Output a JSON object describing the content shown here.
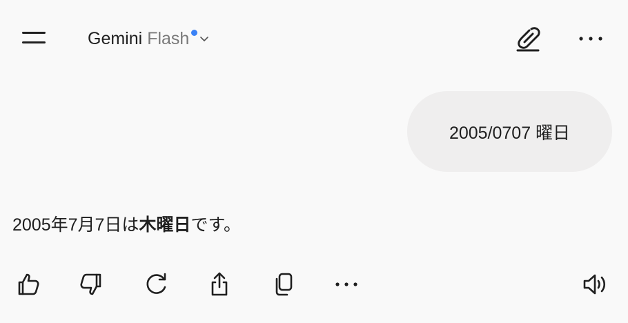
{
  "header": {
    "model_name": "Gemini",
    "model_variant": "Flash",
    "icons": [
      "menu-icon",
      "chevron-down-icon",
      "new-chat-icon",
      "more-horizontal-icon"
    ]
  },
  "conversation": {
    "user_message": "2005/0707 曜日",
    "response": {
      "prefix": "2005年7月7日は",
      "bold": "木曜日",
      "suffix": "です。"
    }
  },
  "response_actions": {
    "icons": [
      "thumbs-up-icon",
      "thumbs-down-icon",
      "regenerate-icon",
      "share-icon",
      "copy-icon",
      "more-horizontal-icon",
      "speaker-icon"
    ]
  },
  "colors": {
    "background": "#f9f9f9",
    "bubble": "#efeeee",
    "text": "#1f1f1f",
    "muted": "#7a7a7a",
    "accent_dot": "#3b82f6"
  }
}
